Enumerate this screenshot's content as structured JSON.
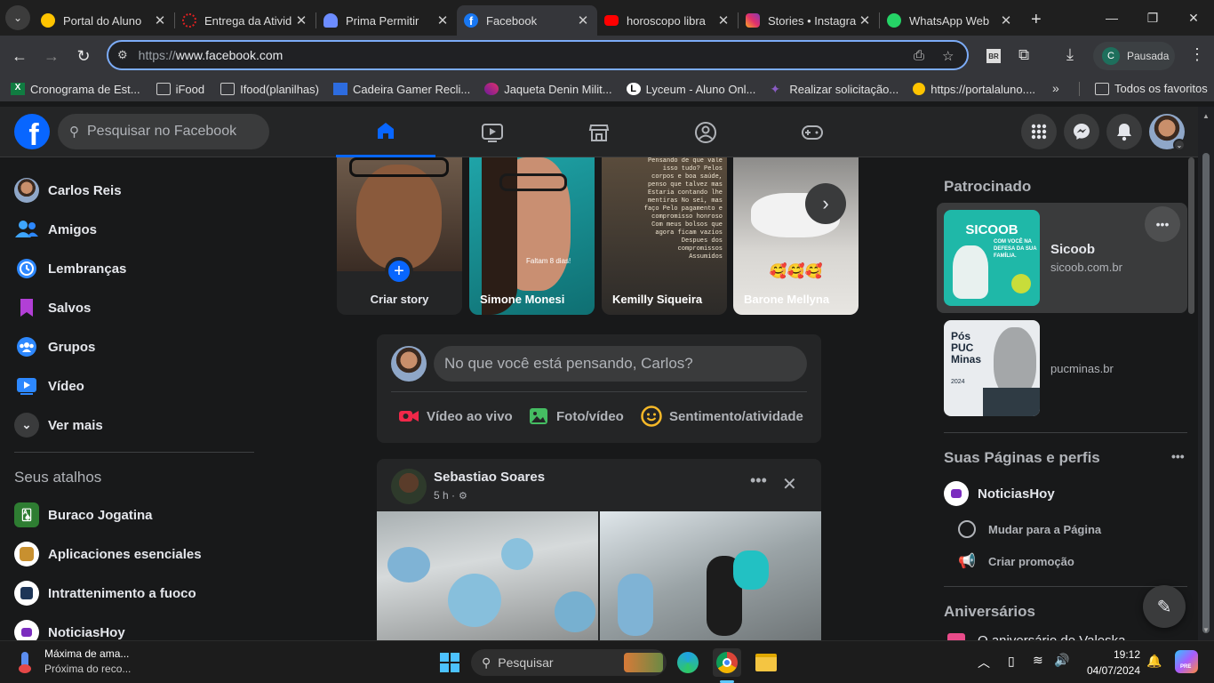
{
  "browser": {
    "tabs": [
      {
        "title": "Portal do Aluno",
        "icon": "portal-icon",
        "color": "#ffc400"
      },
      {
        "title": "Entrega da Ativid",
        "icon": "loading-icon",
        "color": "#e02020"
      },
      {
        "title": "Prima Permitir",
        "icon": "bell-icon",
        "color": "#6c8cff"
      },
      {
        "title": "Facebook",
        "icon": "facebook-icon",
        "color": "#1877f2"
      },
      {
        "title": "horoscopo libra",
        "icon": "youtube-icon",
        "color": "#ff0000"
      },
      {
        "title": "Stories • Instagra",
        "icon": "instagram-icon",
        "color": "#e1306c"
      },
      {
        "title": "WhatsApp Web",
        "icon": "whatsapp-icon",
        "color": "#25d366"
      }
    ],
    "url_scheme": "https://",
    "url_host": "www.facebook.com",
    "profile_initial": "C",
    "profile_status": "Pausada",
    "ext_label": "BR",
    "bookmarks": [
      {
        "label": "Cronograma de Est...",
        "icon": "excel-icon"
      },
      {
        "label": "iFood",
        "icon": "folder-icon"
      },
      {
        "label": "Ifood(planilhas)",
        "icon": "folder-icon"
      },
      {
        "label": "Cadeira Gamer Recli...",
        "icon": "ml-icon"
      },
      {
        "label": "Jaqueta Denin Milit...",
        "icon": "shop-icon"
      },
      {
        "label": "Lyceum - Aluno Onl...",
        "icon": "lyceum-icon"
      },
      {
        "label": "Realizar solicitação...",
        "icon": "sparkle-icon"
      },
      {
        "label": "https://portalaluno....",
        "icon": "portal-icon"
      }
    ],
    "all_favorites": "Todos os favoritos"
  },
  "fb": {
    "search_placeholder": "Pesquisar no Facebook",
    "left_nav": [
      {
        "label": "Carlos Reis",
        "icon": "avatar"
      },
      {
        "label": "Amigos",
        "icon": "friends-icon"
      },
      {
        "label": "Lembranças",
        "icon": "memories-icon"
      },
      {
        "label": "Salvos",
        "icon": "saved-icon"
      },
      {
        "label": "Grupos",
        "icon": "groups-icon"
      },
      {
        "label": "Vídeo",
        "icon": "video-icon"
      },
      {
        "label": "Ver mais",
        "icon": "chevron-down-icon"
      }
    ],
    "shortcuts_title": "Seus atalhos",
    "shortcuts": [
      {
        "label": "Buraco Jogatina"
      },
      {
        "label": "Aplicaciones esenciales"
      },
      {
        "label": "Intrattenimento a fuoco"
      },
      {
        "label": "NoticiasHoy"
      }
    ],
    "stories": [
      {
        "name": "Criar story"
      },
      {
        "name": "Simone Monesi",
        "caption": "Faltam 8 dias!"
      },
      {
        "name": "Kemilly Siqueira",
        "caption": "Pensando de que vale isso tudo? Pelos corpos e boa saúde, penso que talvez mas Estaria contando lhe mentiras No sei, mas faço Pelo pagamento e compromisso honroso Com meus bolsos que agora ficam vazios Despues dos compromissos Assumidos"
      },
      {
        "name": "Barone Mellyna",
        "caption": "🥰🥰🥰"
      }
    ],
    "composer": {
      "placeholder": "No que você está pensando, Carlos?",
      "live": "Vídeo ao vivo",
      "photo": "Foto/vídeo",
      "feeling": "Sentimento/atividade"
    },
    "post": {
      "author": "Sebastiao Soares",
      "time": "5 h ·"
    },
    "sponsored_title": "Patrocinado",
    "ads": [
      {
        "title": "Sicoob",
        "domain": "sicoob.com.br",
        "img_brand": "SICOOB",
        "img_text": "COM VOCÊ NA DEFESA DA SUA FAMÍLIA."
      },
      {
        "title": "",
        "domain": "pucminas.br",
        "img_brand": "Pós PUC Minas",
        "img_year": "2024"
      }
    ],
    "pages_title": "Suas Páginas e perfis",
    "page_name": "NoticiasHoy",
    "switch_page": "Mudar para a Página",
    "create_promo": "Criar promoção",
    "birthdays_title": "Aniversários",
    "birthday_text": "O aniversário de Valeska"
  },
  "taskbar": {
    "weather_title": "Máxima de ama...",
    "weather_sub": "Próxima do reco...",
    "search": "Pesquisar",
    "time": "19:12",
    "date": "04/07/2024",
    "copilot_badge": "PRE"
  }
}
